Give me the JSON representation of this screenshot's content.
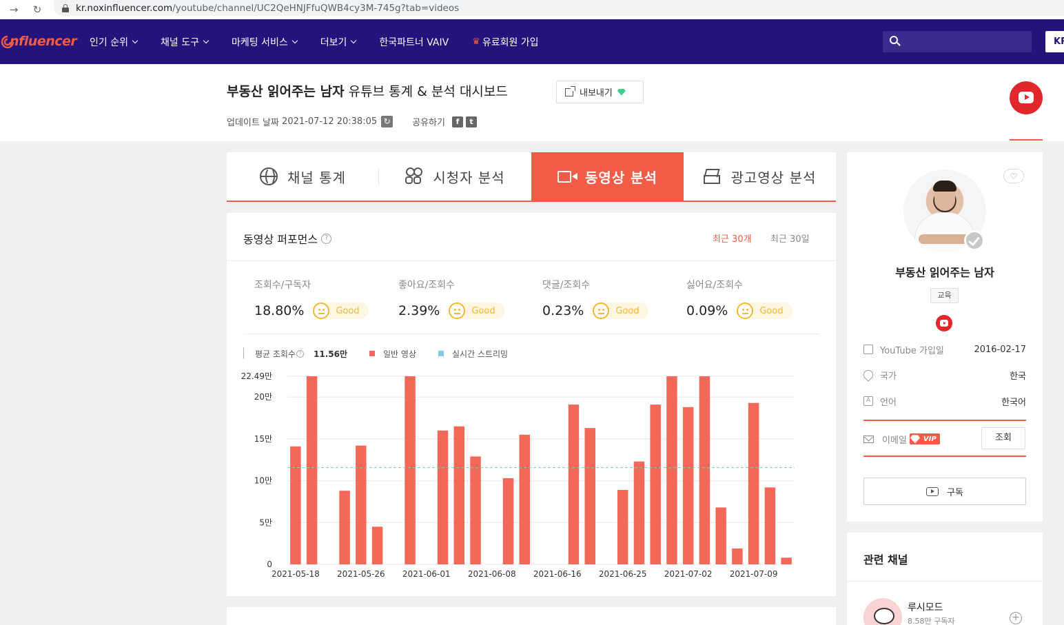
{
  "browser": {
    "url_host": "kr.noxinfluencer.com",
    "url_path": "/youtube/channel/UC2QeHNJFfuQWB4cy3M-745g?tab=videos"
  },
  "header": {
    "logo": "nfluencer",
    "menu": [
      {
        "label": "인기 순위",
        "has_dropdown": true
      },
      {
        "label": "채널 도구",
        "has_dropdown": true
      },
      {
        "label": "마케팅 서비스",
        "has_dropdown": true
      },
      {
        "label": "더보기",
        "has_dropdown": true
      },
      {
        "label": "한국파트너 VAIV",
        "has_dropdown": false
      },
      {
        "label": "유료회원 가입",
        "has_dropdown": false,
        "icon": "crown-icon"
      }
    ],
    "search": {
      "placeholder": ""
    },
    "lang": "KR",
    "colors": {
      "nav_bg": "#24137a",
      "accent": "#f25b46"
    }
  },
  "title": {
    "channel_name": "부동산 읽어주는 남자",
    "suffix": "유튜브 통계 & 분석 대시보드",
    "export_label": "내보내기",
    "update_label": "업데이트 날짜",
    "update_time": "2021-07-12 20:38:05",
    "share_label": "공유하기"
  },
  "tabs": [
    {
      "label": "채널 통계",
      "icon": "globe-icon",
      "active": false
    },
    {
      "label": "시청자 분석",
      "icon": "people-icon",
      "active": false
    },
    {
      "label": "동영상 분석",
      "icon": "video-icon",
      "active": true
    },
    {
      "label": "광고영상 분석",
      "icon": "ad-icon",
      "active": false
    }
  ],
  "performance": {
    "title": "동영상 퍼포먼스",
    "range_options": [
      {
        "label": "최근 30개",
        "active": true
      },
      {
        "label": "최근 30일",
        "active": false
      }
    ],
    "metrics": [
      {
        "label": "조회수/구독자",
        "value": "18.80%",
        "rating": "Good"
      },
      {
        "label": "좋아요/조회수",
        "value": "2.39%",
        "rating": "Good"
      },
      {
        "label": "댓글/조회수",
        "value": "0.23%",
        "rating": "Good"
      },
      {
        "label": "싫어요/조회수",
        "value": "0.09%",
        "rating": "Good"
      }
    ],
    "legend": {
      "avg_label": "평균 조회수",
      "avg_value": "11.56만",
      "regular_label": "일반 영상",
      "live_label": "실시간 스트리밍",
      "regular_color": "#f4685a",
      "live_color": "#7ecbe8"
    }
  },
  "chart_data": {
    "type": "bar",
    "ylabel": "",
    "ylim": [
      0,
      22.49
    ],
    "ymax_label": "22.49만",
    "y_ticks": [
      {
        "value": 0,
        "label": "0"
      },
      {
        "value": 5,
        "label": "5만"
      },
      {
        "value": 10,
        "label": "10만"
      },
      {
        "value": 15,
        "label": "15만"
      },
      {
        "value": 20,
        "label": "20만"
      },
      {
        "value": 22.49,
        "label": "22.49만"
      }
    ],
    "x_tick_labels": [
      {
        "index": 0,
        "label": "2021-05-18"
      },
      {
        "index": 4,
        "label": "2021-05-26"
      },
      {
        "index": 8,
        "label": "2021-06-01"
      },
      {
        "index": 12,
        "label": "2021-06-08"
      },
      {
        "index": 16,
        "label": "2021-06-16"
      },
      {
        "index": 20,
        "label": "2021-06-25"
      },
      {
        "index": 24,
        "label": "2021-07-02"
      },
      {
        "index": 28,
        "label": "2021-07-09"
      }
    ],
    "average": 11.56,
    "series": [
      {
        "name": "일반 영상",
        "values": [
          14.1,
          22.49,
          0,
          8.8,
          14.2,
          4.5,
          0,
          22.49,
          0,
          16.0,
          16.5,
          12.9,
          0,
          10.3,
          15.5,
          0,
          0,
          19.1,
          16.3,
          0,
          8.9,
          12.3,
          19.1,
          22.49,
          18.8,
          22.49,
          6.8,
          1.9,
          19.3,
          9.2,
          0.8
        ]
      }
    ]
  },
  "profile": {
    "name": "부동산 읽어주는 남자",
    "category": "교육",
    "rows": [
      {
        "label": "YouTube 가입일",
        "value": "2016-02-17",
        "icon": "calendar-icon"
      },
      {
        "label": "국가",
        "value": "한국",
        "icon": "location-pin-icon"
      },
      {
        "label": "언어",
        "value": "한국어",
        "icon": "language-icon"
      }
    ],
    "email_label": "이메일",
    "vip_label": "VIP",
    "lookup_label": "조회",
    "subscribe_label": "구독"
  },
  "related": {
    "title": "관련 채널",
    "items": [
      {
        "name": "루시모드",
        "subs": "8.58만 구독자"
      }
    ]
  }
}
